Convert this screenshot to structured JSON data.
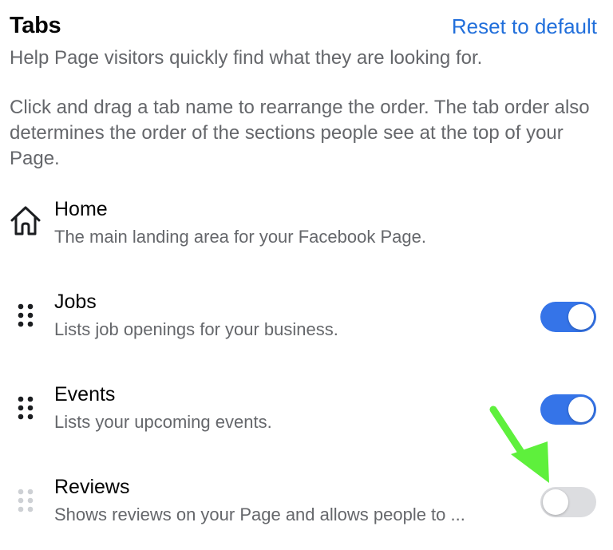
{
  "header": {
    "title": "Tabs",
    "reset_label": "Reset to default"
  },
  "intro": {
    "line1": "Help Page visitors quickly find what they are looking for.",
    "line2": "Click and drag a tab name to rearrange the order. The tab order also determines the order of the sections people see at the top of your Page."
  },
  "tabs": [
    {
      "name": "Home",
      "description": "The main landing area for your Facebook Page.",
      "icon": "home-icon",
      "toggle": null
    },
    {
      "name": "Jobs",
      "description": "Lists job openings for your business.",
      "icon": "drag-handle-icon",
      "toggle": true
    },
    {
      "name": "Events",
      "description": "Lists your upcoming events.",
      "icon": "drag-handle-icon",
      "toggle": true
    },
    {
      "name": "Reviews",
      "description": "Shows reviews on your Page and allows people to ...",
      "icon": "drag-handle-icon",
      "toggle": false
    }
  ],
  "colors": {
    "accent": "#216fdb",
    "toggle_on": "#3574e8",
    "toggle_off": "#dcdde0",
    "annotation_arrow": "#5ef03c"
  }
}
